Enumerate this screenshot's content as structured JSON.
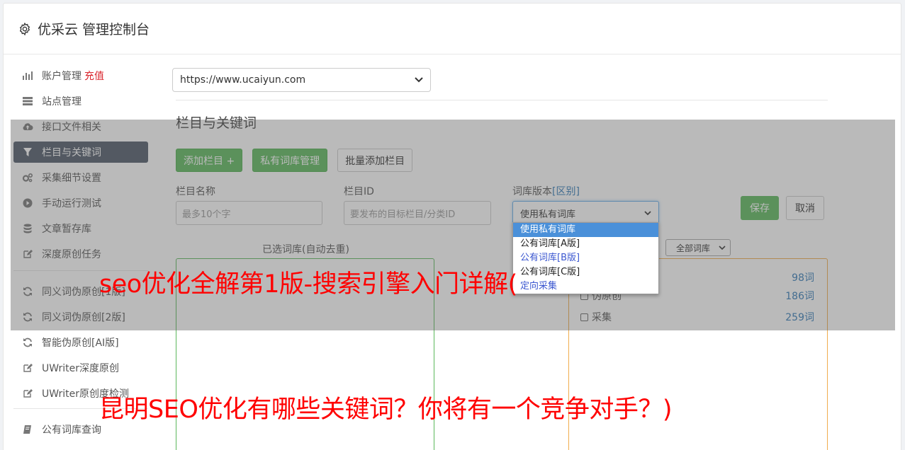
{
  "header": {
    "title": "优采云 管理控制台",
    "icon": "gear-icon"
  },
  "sidebar": {
    "recharge_label": "充值",
    "items": [
      {
        "label": "账户管理",
        "icon": "bar-chart-icon"
      },
      {
        "label": "站点管理",
        "icon": "server-icon"
      },
      {
        "label": "接口文件相关",
        "icon": "cloud-upload-icon"
      },
      {
        "label": "栏目与关键词",
        "icon": "filter-icon",
        "active": true
      },
      {
        "label": "采集细节设置",
        "icon": "cogs-icon"
      },
      {
        "label": "手动运行测试",
        "icon": "play-circle-icon"
      },
      {
        "label": "文章暂存库",
        "icon": "database-icon"
      },
      {
        "label": "深度原创任务",
        "icon": "edit-icon"
      },
      {
        "label": "同义词伪原创[1版]",
        "icon": "refresh-icon"
      },
      {
        "label": "同义词伪原创[2版]",
        "icon": "refresh-icon"
      },
      {
        "label": "智能伪原创[AI版]",
        "icon": "refresh-icon"
      },
      {
        "label": "UWriter深度原创",
        "icon": "edit-icon"
      },
      {
        "label": "UWriter原创度检测",
        "icon": "edit-icon"
      },
      {
        "label": "公有词库查询",
        "icon": "book-icon"
      }
    ]
  },
  "main": {
    "site_select_value": "https://www.ucaiyun.com",
    "section_title": "栏目与关键词",
    "buttons": {
      "add_column": "添加栏目 +",
      "private_lib": "私有词库管理",
      "batch_add": "批量添加栏目"
    },
    "form": {
      "column_name_label": "栏目名称",
      "column_name_placeholder": "最多10个字",
      "column_id_label": "栏目ID",
      "column_id_placeholder": "要发布的目标栏目/分类ID",
      "lib_version_label": "词库版本",
      "lib_version_link": "[区别]",
      "lib_version_value": "使用私有词库",
      "save": "保存",
      "cancel": "取消"
    },
    "dropdown_options": [
      "使用私有词库",
      "公有词库[A版]",
      "公有词库[B版]",
      "公有词库[C版]",
      "定向采集"
    ],
    "selected_lib_label": "已选词库(自动去重)",
    "all_libs_select": "全部词库",
    "libraries": [
      {
        "name": "",
        "count": "98词"
      },
      {
        "name": "伪原创",
        "count": "186词"
      },
      {
        "name": "采集",
        "count": "259词"
      }
    ]
  },
  "overlay_text": {
    "line1": "seo优化全解第1版-搜索引擎入门详解(",
    "line2": "昆明SEO优化有哪些关键词？你将有一个竞争对手？)"
  }
}
